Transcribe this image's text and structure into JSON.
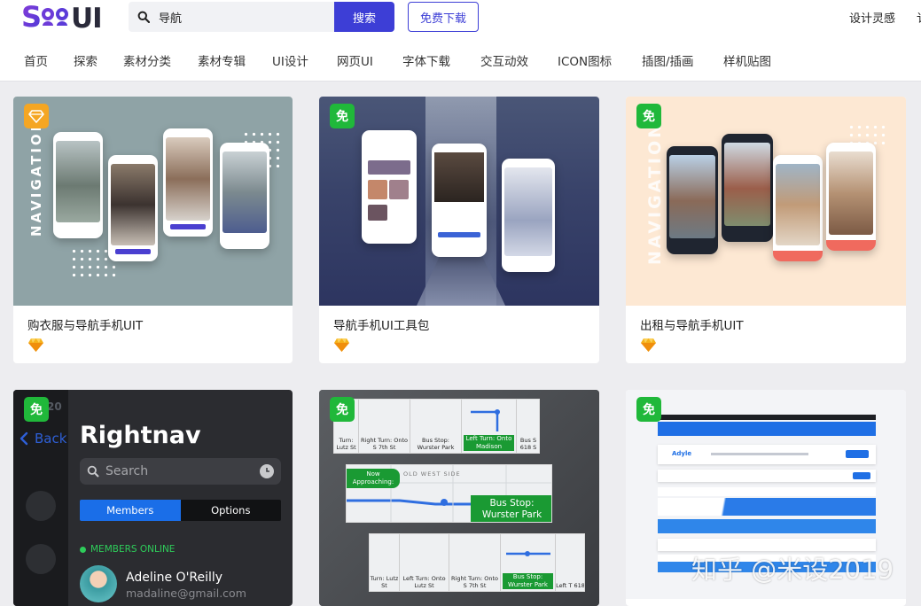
{
  "brand": {
    "logo_text": "SOOUI",
    "colors": {
      "accent": "#3d3ed6",
      "logo_purple": "#6d3bd8",
      "badge_green": "#20b83a",
      "badge_orange": "#f5a623"
    }
  },
  "search": {
    "value": "导航",
    "button_label": "搜索"
  },
  "header": {
    "free_download": "免费下载",
    "design_inspiration": "设计灵感",
    "cut_text": "讠"
  },
  "nav": {
    "items": [
      "首页",
      "探索",
      "素材分类",
      "素材专辑",
      "UI设计",
      "网页UI",
      "字体下载",
      "交互动效",
      "ICON图标",
      "插图/插画",
      "样机贴图"
    ]
  },
  "cards": [
    {
      "title": "购衣服与导航手机UIT",
      "badge": "diamond",
      "vertical_text": "NAVIGATION"
    },
    {
      "title": "导航手机UI工具包",
      "badge": "免"
    },
    {
      "title": "出租与导航手机UIT",
      "badge": "免",
      "vertical_text": "NAVIGATION"
    },
    {
      "title": "",
      "badge": "免",
      "preview": {
        "back": "Back",
        "time": "20",
        "title": "Rightnav",
        "search_placeholder": "Search",
        "tab_members": "Members",
        "tab_options": "Options",
        "online": "MEMBERS ONLINE",
        "user_name": "Adeline O'Reilly",
        "user_email": "madaline@gmail.com"
      }
    },
    {
      "title": "",
      "badge": "免",
      "preview": {
        "row1": [
          "Turn: Lutz St",
          "Right Turn: Onto S 7th St",
          "Bus Stop: Wurster Park",
          "Left Turn: Onto Madison",
          "Bus S 618 S"
        ],
        "approaching": "Now Approaching:",
        "street": "OLD WEST SIDE",
        "bus_stop": "Bus Stop: Wurster Park",
        "row3": [
          "Turn: Lutz St",
          "Left Turn: Onto Lutz St",
          "Right Turn: Onto S 7th St",
          "Bus Stop: Wurster Park",
          "Left T 618"
        ]
      }
    },
    {
      "title": "",
      "badge": "免",
      "preview": {
        "site_name": "Adyle"
      }
    }
  ],
  "watermark": "知乎 @米设2019",
  "icons": [
    "search-icon",
    "diamond-icon",
    "sketch-icon",
    "free-badge-icon",
    "back-chevron-icon",
    "clock-icon",
    "avatar"
  ]
}
